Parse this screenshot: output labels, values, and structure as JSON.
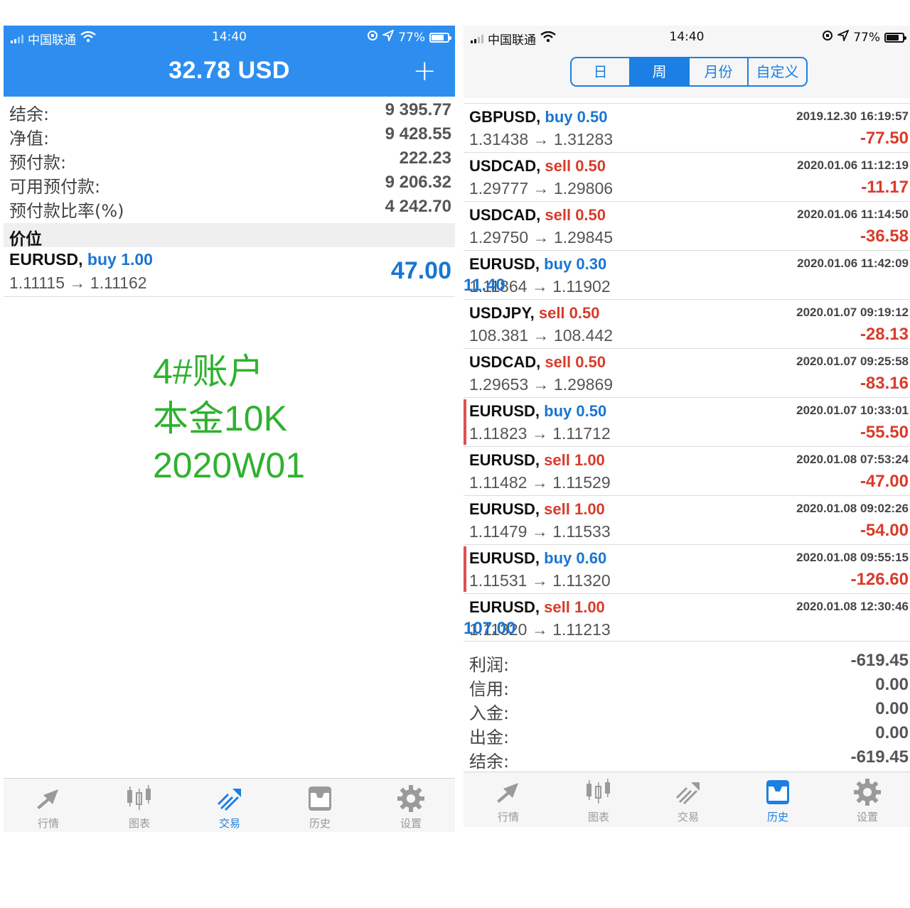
{
  "left": {
    "status": {
      "carrier": "中国联通",
      "time": "14:40",
      "battery": "77%"
    },
    "header": {
      "title": "32.78 USD",
      "add_label": "+"
    },
    "account": [
      {
        "label": "结余:",
        "value": "9 395.77"
      },
      {
        "label": "净值:",
        "value": "9 428.55"
      },
      {
        "label": "预付款:",
        "value": "222.23"
      },
      {
        "label": "可用预付款:",
        "value": "9 206.32"
      },
      {
        "label": "预付款比率(%)",
        "value": "4 242.70"
      }
    ],
    "positions_title": "价位",
    "position": {
      "symbol": "EURUSD,",
      "side": "buy",
      "volume": "1.00",
      "prices": "1.11115 → 1.11162",
      "profit": "47.00"
    },
    "note": [
      "4#账户",
      "本金10K",
      "2020W01"
    ],
    "tabs": [
      {
        "label": "行情",
        "icon": "quotes-icon"
      },
      {
        "label": "图表",
        "icon": "chart-icon"
      },
      {
        "label": "交易",
        "icon": "trade-icon"
      },
      {
        "label": "历史",
        "icon": "history-icon"
      },
      {
        "label": "设置",
        "icon": "settings-icon"
      }
    ],
    "active_tab": "交易"
  },
  "right": {
    "status": {
      "carrier": "中国联通",
      "time": "14:40",
      "battery": "77%"
    },
    "segments": [
      "日",
      "周",
      "月份",
      "自定义"
    ],
    "active_segment": "周",
    "deals": [
      {
        "symbol": "GBPUSD,",
        "side": "buy",
        "volume": "0.50",
        "prices": "1.31438 → 1.31283",
        "date": "2019.12.30 16:19:57",
        "profit": "-77.50",
        "sign": "neg"
      },
      {
        "symbol": "USDCAD,",
        "side": "sell",
        "volume": "0.50",
        "prices": "1.29777 → 1.29806",
        "date": "2020.01.06 11:12:19",
        "profit": "-11.17",
        "sign": "neg"
      },
      {
        "symbol": "USDCAD,",
        "side": "sell",
        "volume": "0.50",
        "prices": "1.29750 → 1.29845",
        "date": "2020.01.06 11:14:50",
        "profit": "-36.58",
        "sign": "neg"
      },
      {
        "symbol": "EURUSD,",
        "side": "buy",
        "volume": "0.30",
        "prices": "1.11864 → 1.11902",
        "date": "2020.01.06 11:42:09",
        "profit": "11.40",
        "sign": "pos"
      },
      {
        "symbol": "USDJPY,",
        "side": "sell",
        "volume": "0.50",
        "prices": "108.381 → 108.442",
        "date": "2020.01.07 09:19:12",
        "profit": "-28.13",
        "sign": "neg"
      },
      {
        "symbol": "USDCAD,",
        "side": "sell",
        "volume": "0.50",
        "prices": "1.29653 → 1.29869",
        "date": "2020.01.07 09:25:58",
        "profit": "-83.16",
        "sign": "neg"
      },
      {
        "symbol": "EURUSD,",
        "side": "buy",
        "volume": "0.50",
        "prices": "1.11823 → 1.11712",
        "date": "2020.01.07 10:33:01",
        "profit": "-55.50",
        "sign": "neg"
      },
      {
        "symbol": "EURUSD,",
        "side": "sell",
        "volume": "1.00",
        "prices": "1.11482 → 1.11529",
        "date": "2020.01.08 07:53:24",
        "profit": "-47.00",
        "sign": "neg"
      },
      {
        "symbol": "EURUSD,",
        "side": "sell",
        "volume": "1.00",
        "prices": "1.11479 → 1.11533",
        "date": "2020.01.08 09:02:26",
        "profit": "-54.00",
        "sign": "neg"
      },
      {
        "symbol": "EURUSD,",
        "side": "buy",
        "volume": "0.60",
        "prices": "1.11531 → 1.11320",
        "date": "2020.01.08 09:55:15",
        "profit": "-126.60",
        "sign": "neg"
      },
      {
        "symbol": "EURUSD,",
        "side": "sell",
        "volume": "1.00",
        "prices": "1.11320 → 1.11213",
        "date": "2020.01.08 12:30:46",
        "profit": "107.00",
        "sign": "pos"
      }
    ],
    "summary": [
      {
        "label": "利润:",
        "value": "-619.45"
      },
      {
        "label": "信用:",
        "value": "0.00"
      },
      {
        "label": "入金:",
        "value": "0.00"
      },
      {
        "label": "出金:",
        "value": "0.00"
      },
      {
        "label": "结余:",
        "value": "-619.45"
      }
    ],
    "tabs": [
      {
        "label": "行情",
        "icon": "quotes-icon"
      },
      {
        "label": "图表",
        "icon": "chart-icon"
      },
      {
        "label": "交易",
        "icon": "trade-icon"
      },
      {
        "label": "历史",
        "icon": "history-icon"
      },
      {
        "label": "设置",
        "icon": "settings-icon"
      }
    ],
    "active_tab": "历史"
  },
  "colors": {
    "accent": "#2d8ef0",
    "buy": "#1a75d2",
    "sell": "#d83b2a",
    "note": "#2fb12f"
  }
}
